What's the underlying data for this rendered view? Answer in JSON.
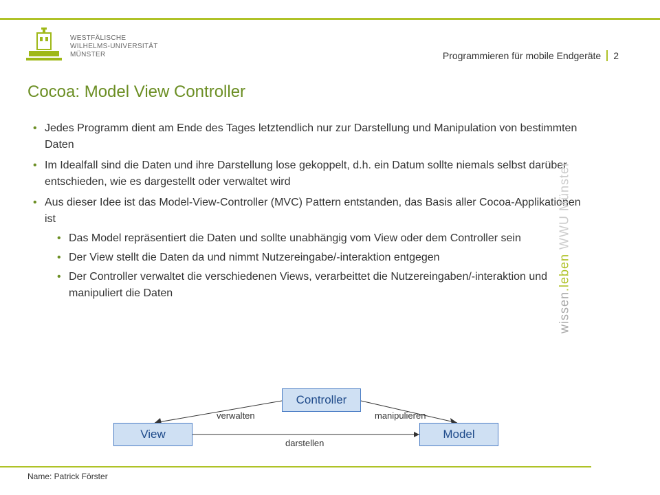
{
  "header": {
    "uni_lines": [
      "WESTFÄLISCHE",
      "WILHELMS-UNIVERSITÄT",
      "MÜNSTER"
    ],
    "course": "Programmieren für mobile Endgeräte",
    "page_number": "2"
  },
  "title": "Cocoa: Model View Controller",
  "bullets": [
    "Jedes Programm dient am Ende des Tages letztendlich nur zur Darstellung und Manipulation von bestimmten Daten",
    "Im Idealfall sind die Daten und ihre Darstellung lose gekoppelt, d.h. ein Datum sollte niemals selbst darüber entschieden, wie es dargestellt oder verwaltet wird",
    "Aus dieser Idee ist das Model-View-Controller (MVC) Pattern entstanden, das Basis aller Cocoa-Applikationen ist"
  ],
  "sub_bullets": [
    "Das Model repräsentiert die Daten und sollte unabhängig vom View oder dem Controller sein",
    "Der View stellt die Daten da und nimmt Nutzereingabe/-interaktion entgegen",
    "Der Controller verwaltet die verschiedenen Views, verarbeittet die Nutzereingaben/-interaktion und manipuliert die Daten"
  ],
  "diagram": {
    "view": "View",
    "controller": "Controller",
    "model": "Model",
    "verwalten": "verwalten",
    "darstellen": "darstellen",
    "manipulieren": "manipulieren"
  },
  "side": {
    "part1": "wissen",
    "part2": ".leben",
    "part3": " WWU Münster"
  },
  "footer": {
    "name": "Name: Patrick Förster"
  }
}
